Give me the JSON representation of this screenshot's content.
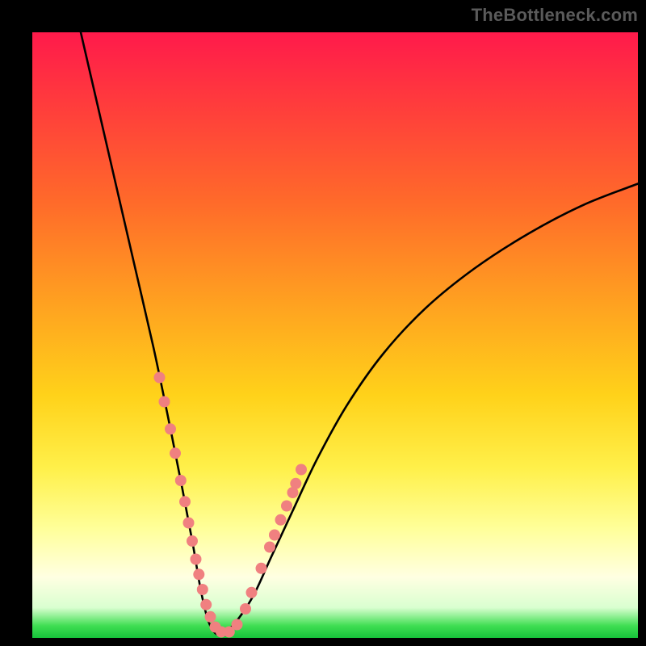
{
  "watermark": "TheBottleneck.com",
  "chart_data": {
    "type": "line",
    "title": "",
    "xlabel": "",
    "ylabel": "",
    "xlim": [
      0,
      1
    ],
    "ylim": [
      0,
      1
    ],
    "note": "Axes are unlabeled; x and y are normalized 0–1 within the gradient plot area. y=1 is top (red, high bottleneck), y≈0 is bottom (green, optimal).",
    "series": [
      {
        "name": "bottleneck-curve",
        "x": [
          0.08,
          0.11,
          0.14,
          0.17,
          0.2,
          0.225,
          0.248,
          0.265,
          0.278,
          0.29,
          0.302,
          0.315,
          0.335,
          0.365,
          0.395,
          0.43,
          0.47,
          0.52,
          0.58,
          0.65,
          0.73,
          0.82,
          0.91,
          1.0
        ],
        "y": [
          1.0,
          0.87,
          0.74,
          0.61,
          0.48,
          0.36,
          0.245,
          0.155,
          0.08,
          0.03,
          0.008,
          0.008,
          0.025,
          0.07,
          0.135,
          0.21,
          0.295,
          0.385,
          0.47,
          0.545,
          0.61,
          0.668,
          0.715,
          0.75
        ]
      }
    ],
    "markers": {
      "name": "highlight-dots",
      "color": "#f08080",
      "radius_px": 7,
      "points_xy": [
        [
          0.21,
          0.43
        ],
        [
          0.218,
          0.39
        ],
        [
          0.228,
          0.345
        ],
        [
          0.236,
          0.305
        ],
        [
          0.245,
          0.26
        ],
        [
          0.252,
          0.225
        ],
        [
          0.258,
          0.19
        ],
        [
          0.264,
          0.16
        ],
        [
          0.27,
          0.13
        ],
        [
          0.275,
          0.105
        ],
        [
          0.281,
          0.08
        ],
        [
          0.287,
          0.055
        ],
        [
          0.294,
          0.035
        ],
        [
          0.302,
          0.018
        ],
        [
          0.312,
          0.01
        ],
        [
          0.325,
          0.01
        ],
        [
          0.338,
          0.022
        ],
        [
          0.352,
          0.048
        ],
        [
          0.362,
          0.075
        ],
        [
          0.378,
          0.115
        ],
        [
          0.392,
          0.15
        ],
        [
          0.4,
          0.17
        ],
        [
          0.41,
          0.195
        ],
        [
          0.42,
          0.218
        ],
        [
          0.43,
          0.24
        ],
        [
          0.435,
          0.255
        ],
        [
          0.444,
          0.278
        ]
      ]
    }
  }
}
